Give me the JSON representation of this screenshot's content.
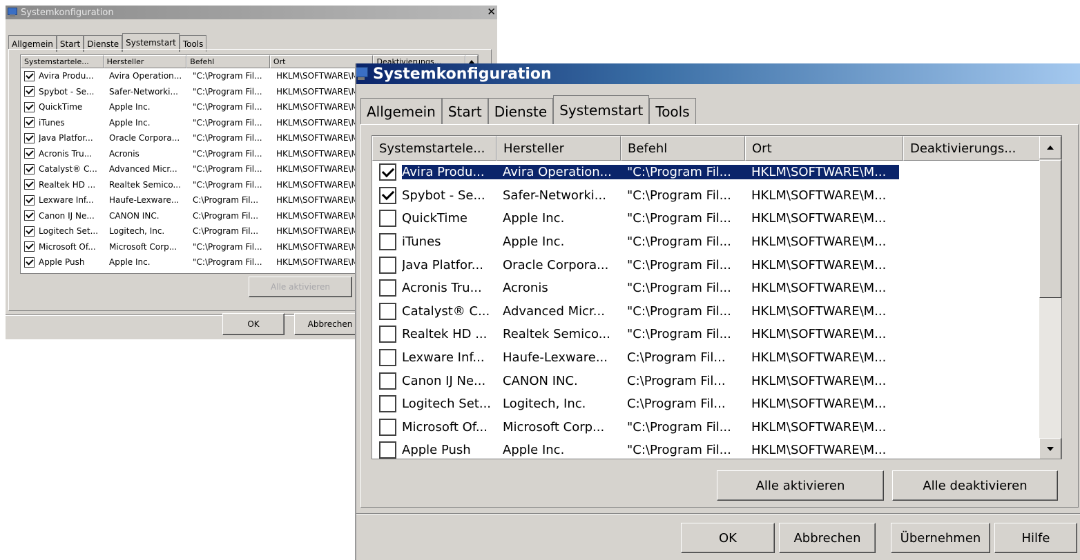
{
  "window_title": "Systemkonfiguration",
  "close_glyph": "✕",
  "tabs": [
    "Allgemein",
    "Start",
    "Dienste",
    "Systemstart",
    "Tools"
  ],
  "active_tab": "Systemstart",
  "columns": [
    "Systemstartele...",
    "Hersteller",
    "Befehl",
    "Ort",
    "Deaktivierungs..."
  ],
  "small_columns": [
    "Systemstartele...",
    "Hersteller",
    "Befehl",
    "Ort",
    "Deaktivierungs..."
  ],
  "small_rows": [
    {
      "name": "Avira Produ...",
      "manufacturer": "Avira Operation...",
      "command": "\"C:\\Program Fil...",
      "location": "HKLM\\SOFTWARE\\M...",
      "checked": true
    },
    {
      "name": "Spybot - Se...",
      "manufacturer": "Safer-Networki...",
      "command": "\"C:\\Program Fil...",
      "location": "HKLM\\SOFTWARE\\M...",
      "checked": true
    },
    {
      "name": "QuickTime",
      "manufacturer": "Apple Inc.",
      "command": "\"C:\\Program Fil...",
      "location": "HKLM\\SOFTWARE\\M...",
      "checked": true
    },
    {
      "name": "iTunes",
      "manufacturer": "Apple Inc.",
      "command": "\"C:\\Program Fil...",
      "location": "HKLM\\SOFTWARE\\M...",
      "checked": true
    },
    {
      "name": "Java Platfor...",
      "manufacturer": "Oracle Corpora...",
      "command": "\"C:\\Program Fil...",
      "location": "HKLM\\SOFTWARE\\M...",
      "checked": true
    },
    {
      "name": "Acronis Tru...",
      "manufacturer": "Acronis",
      "command": "\"C:\\Program Fil...",
      "location": "HKLM\\SOFTWARE\\M...",
      "checked": true
    },
    {
      "name": "Catalyst® C...",
      "manufacturer": "Advanced Micr...",
      "command": "\"C:\\Program Fil...",
      "location": "HKLM\\SOFTWARE\\M...",
      "checked": true
    },
    {
      "name": "Realtek HD ...",
      "manufacturer": "Realtek Semico...",
      "command": "\"C:\\Program Fil...",
      "location": "HKLM\\SOFTWARE\\M...",
      "checked": true
    },
    {
      "name": "Lexware Inf...",
      "manufacturer": "Haufe-Lexware...",
      "command": "C:\\Program Fil...",
      "location": "HKLM\\SOFTWARE\\M...",
      "checked": true
    },
    {
      "name": "Canon IJ Ne...",
      "manufacturer": "CANON INC.",
      "command": "C:\\Program Fil...",
      "location": "HKLM\\SOFTWARE\\M...",
      "checked": true
    },
    {
      "name": "Logitech Set...",
      "manufacturer": "Logitech, Inc.",
      "command": "C:\\Program Fil...",
      "location": "HKLM\\SOFTWARE\\M...",
      "checked": true
    },
    {
      "name": "Microsoft Of...",
      "manufacturer": "Microsoft Corp...",
      "command": "\"C:\\Program Fil...",
      "location": "HKLM\\SOFTWARE\\M...",
      "checked": true
    },
    {
      "name": "Apple Push",
      "manufacturer": "Apple Inc.",
      "command": "\"C:\\Program Fil...",
      "location": "HKLM\\SOFTWARE\\M...",
      "checked": true
    }
  ],
  "large_rows": [
    {
      "name": "Avira Produ...",
      "manufacturer": "Avira Operation...",
      "command": "\"C:\\Program Fil...",
      "location": "HKLM\\SOFTWARE\\M...",
      "checked": true,
      "selected": true
    },
    {
      "name": "Spybot - Se...",
      "manufacturer": "Safer-Networki...",
      "command": "\"C:\\Program Fil...",
      "location": "HKLM\\SOFTWARE\\M...",
      "checked": true
    },
    {
      "name": "QuickTime",
      "manufacturer": "Apple Inc.",
      "command": "\"C:\\Program Fil...",
      "location": "HKLM\\SOFTWARE\\M...",
      "checked": false
    },
    {
      "name": "iTunes",
      "manufacturer": "Apple Inc.",
      "command": "\"C:\\Program Fil...",
      "location": "HKLM\\SOFTWARE\\M...",
      "checked": false
    },
    {
      "name": "Java Platfor...",
      "manufacturer": "Oracle Corpora...",
      "command": "\"C:\\Program Fil...",
      "location": "HKLM\\SOFTWARE\\M...",
      "checked": false
    },
    {
      "name": "Acronis Tru...",
      "manufacturer": "Acronis",
      "command": "\"C:\\Program Fil...",
      "location": "HKLM\\SOFTWARE\\M...",
      "checked": false
    },
    {
      "name": "Catalyst® C...",
      "manufacturer": "Advanced Micr...",
      "command": "\"C:\\Program Fil...",
      "location": "HKLM\\SOFTWARE\\M...",
      "checked": false
    },
    {
      "name": "Realtek HD ...",
      "manufacturer": "Realtek Semico...",
      "command": "\"C:\\Program Fil...",
      "location": "HKLM\\SOFTWARE\\M...",
      "checked": false
    },
    {
      "name": "Lexware Inf...",
      "manufacturer": "Haufe-Lexware...",
      "command": "C:\\Program Fil...",
      "location": "HKLM\\SOFTWARE\\M...",
      "checked": false
    },
    {
      "name": "Canon IJ Ne...",
      "manufacturer": "CANON INC.",
      "command": "C:\\Program Fil...",
      "location": "HKLM\\SOFTWARE\\M...",
      "checked": false
    },
    {
      "name": "Logitech Set...",
      "manufacturer": "Logitech, Inc.",
      "command": "C:\\Program Fil...",
      "location": "HKLM\\SOFTWARE\\M...",
      "checked": false
    },
    {
      "name": "Microsoft Of...",
      "manufacturer": "Microsoft Corp...",
      "command": "\"C:\\Program Fil...",
      "location": "HKLM\\SOFTWARE\\M...",
      "checked": false
    },
    {
      "name": "Apple Push",
      "manufacturer": "Apple Inc.",
      "command": "\"C:\\Program Fil...",
      "location": "HKLM\\SOFTWARE\\M...",
      "checked": false
    }
  ],
  "buttons": {
    "enable_all": "Alle aktivieren",
    "disable_all": "Alle deaktivieren",
    "ok": "OK",
    "cancel": "Abbrechen",
    "apply": "Übernehmen",
    "help": "Hilfe"
  },
  "colors": {
    "selection": "#0a246a",
    "dialog_bg": "#d6d3ce",
    "title_active": "#0a246a",
    "title_inactive": "#8a8a8a"
  }
}
